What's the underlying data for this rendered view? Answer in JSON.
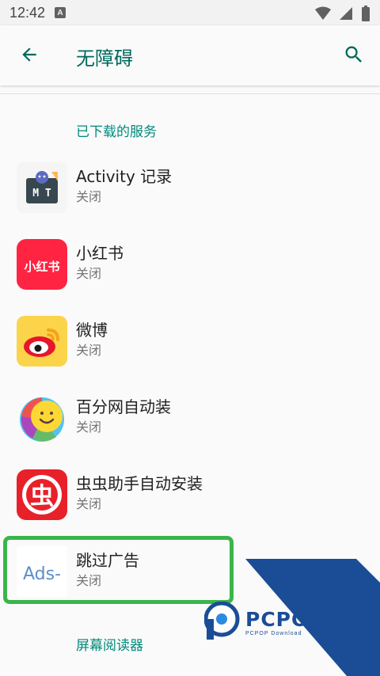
{
  "status_bar": {
    "time": "12:42",
    "notification_letter": "A"
  },
  "app_bar": {
    "title": "无障碍"
  },
  "sections": {
    "downloaded": "已下载的服务",
    "screen_readers": "屏幕阅读器"
  },
  "services": [
    {
      "name": "Activity 记录",
      "status": "关闭",
      "icon": "mt-icon",
      "icon_text": "M T"
    },
    {
      "name": "小红书",
      "status": "关闭",
      "icon": "xiaohongshu-icon",
      "icon_text": "小红书"
    },
    {
      "name": "微博",
      "status": "关闭",
      "icon": "weibo-icon"
    },
    {
      "name": "百分网自动装",
      "status": "关闭",
      "icon": "baifen-icon"
    },
    {
      "name": "虫虫助手自动安装",
      "status": "关闭",
      "icon": "chongchong-icon",
      "icon_text": "虫"
    },
    {
      "name": "跳过广告",
      "status": "关闭",
      "icon": "ads-icon",
      "icon_text": "Ads-"
    }
  ],
  "watermark": {
    "brand": "PCPOP下载",
    "sub": "PCPOP Download"
  },
  "colors": {
    "accent": "#00695c",
    "section": "#00897b",
    "highlight": "#3bb54a",
    "watermark": "#1a4d96"
  }
}
